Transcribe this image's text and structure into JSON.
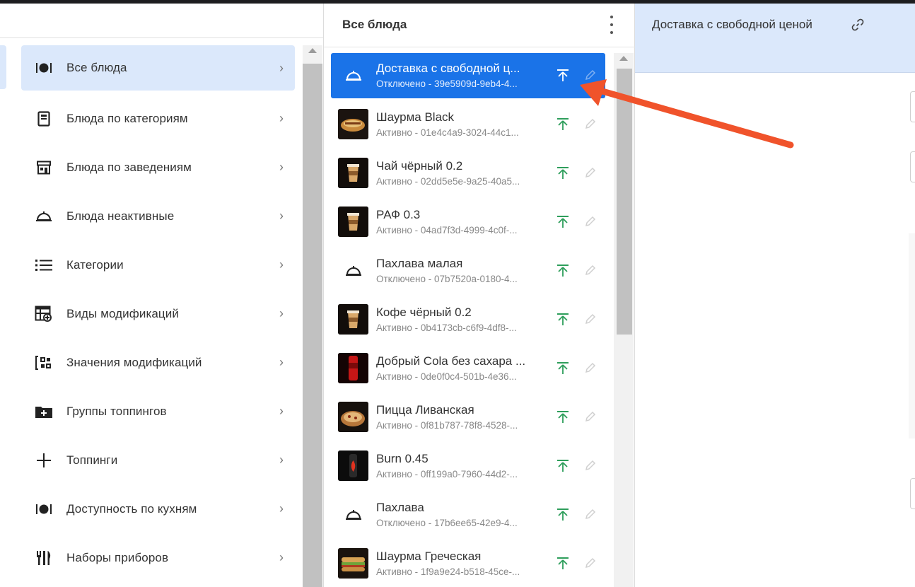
{
  "left_menu": {
    "items": [
      {
        "label": "Все блюда",
        "icon": "dish-cloche-icon",
        "active": true
      },
      {
        "label": "Блюда по категориям",
        "icon": "document-icon",
        "active": false
      },
      {
        "label": "Блюда по заведениям",
        "icon": "store-icon",
        "active": false
      },
      {
        "label": "Блюда неактивные",
        "icon": "cloche-icon",
        "active": false
      },
      {
        "label": "Категории",
        "icon": "list-icon",
        "active": false
      },
      {
        "label": "Виды модификаций",
        "icon": "table-plus-icon",
        "active": false
      },
      {
        "label": "Значения модификаций",
        "icon": "bracket-grid-icon",
        "active": false
      },
      {
        "label": "Группы топпингов",
        "icon": "folder-plus-icon",
        "active": false
      },
      {
        "label": "Топпинги",
        "icon": "plus-icon",
        "active": false
      },
      {
        "label": "Доступность по кухням",
        "icon": "dish-cloche-icon",
        "active": false
      },
      {
        "label": "Наборы приборов",
        "icon": "cutlery-icon",
        "active": false
      }
    ]
  },
  "middle": {
    "title": "Все блюда",
    "items": [
      {
        "name": "Доставка с свободной ц...",
        "sub": "Отключено - 39e5909d-9eb4-4...",
        "thumb": "cloche",
        "selected": true
      },
      {
        "name": "Шаурма Black",
        "sub": "Активно - 01e4c4a9-3024-44c1...",
        "thumb": "wrap",
        "selected": false
      },
      {
        "name": "Чай чёрный 0.2",
        "sub": "Активно - 02dd5e5e-9a25-40a5...",
        "thumb": "cup",
        "selected": false
      },
      {
        "name": "РАФ 0.3",
        "sub": "Активно - 04ad7f3d-4999-4c0f-...",
        "thumb": "cup",
        "selected": false
      },
      {
        "name": "Пахлава малая",
        "sub": "Отключено - 07b7520a-0180-4...",
        "thumb": "cloche",
        "selected": false
      },
      {
        "name": "Кофе чёрный 0.2",
        "sub": "Активно - 0b4173cb-c6f9-4df8-...",
        "thumb": "cup",
        "selected": false
      },
      {
        "name": "Добрый Cola без сахара ...",
        "sub": "Активно - 0de0f0c4-501b-4e36...",
        "thumb": "can-red",
        "selected": false
      },
      {
        "name": "Пицца Ливанская",
        "sub": "Активно - 0f81b787-78f8-4528-...",
        "thumb": "pizza",
        "selected": false
      },
      {
        "name": "Burn 0.45",
        "sub": "Активно - 0ff199a0-7960-44d2-...",
        "thumb": "can-dark",
        "selected": false
      },
      {
        "name": "Пахлава",
        "sub": "Отключено - 17b6ee65-42e9-4...",
        "thumb": "cloche",
        "selected": false
      },
      {
        "name": "Шаурма Греческая",
        "sub": "Активно - 1f9a9e24-b518-45ce-...",
        "thumb": "sandwich",
        "selected": false
      }
    ]
  },
  "right": {
    "title": "Доставка с свободной ценой"
  },
  "colors": {
    "accent": "#1a73e8",
    "active_bg": "#dbe8fb",
    "publish_green": "#2e9e5b",
    "annotation_arrow": "#f0532b"
  }
}
